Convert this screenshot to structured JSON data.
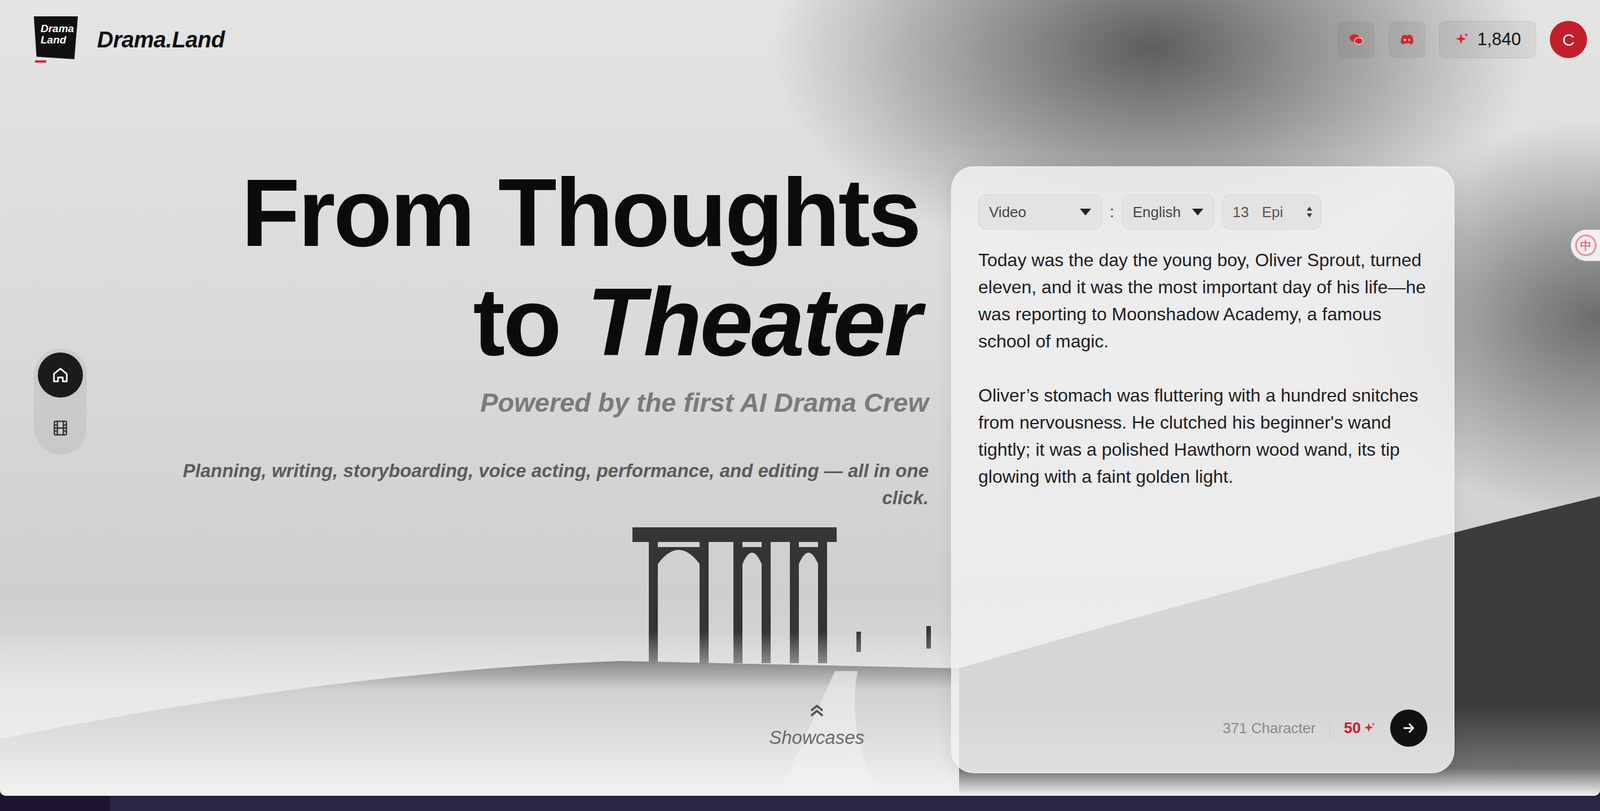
{
  "logo": {
    "badge": "Drama Land",
    "name": "Drama.Land"
  },
  "header": {
    "credits": "1,840",
    "avatar": "C"
  },
  "sidebar": {
    "items": [
      {
        "selected": true
      },
      {
        "selected": false
      }
    ]
  },
  "hero": {
    "line1": "From Thoughts",
    "line2_plain": "to",
    "line2_italic": "Theater",
    "subtitle": "Powered by the first AI Drama Crew",
    "description": "Planning, writing, storyboarding, voice acting, performance, and editing — all in one click."
  },
  "showcases": {
    "label": "Showcases"
  },
  "composer": {
    "format": "Video",
    "separator": ":",
    "language": "English",
    "episodes": "13",
    "episodes_unit": "Epi",
    "text": "Today was the day the young boy, Oliver Sprout, turned eleven, and it was the most important day of his life—he was reporting to Moonshadow Academy, a famous school of magic.\n\nOliver’s stomach was fluttering with a hundred snitches from nervousness. He clutched his beginner's wand tightly; it was a polished Hawthorn wood wand, its tip glowing with a faint golden light.",
    "char_count": "371 Character",
    "cost": "50"
  },
  "lang_toggle": "中"
}
